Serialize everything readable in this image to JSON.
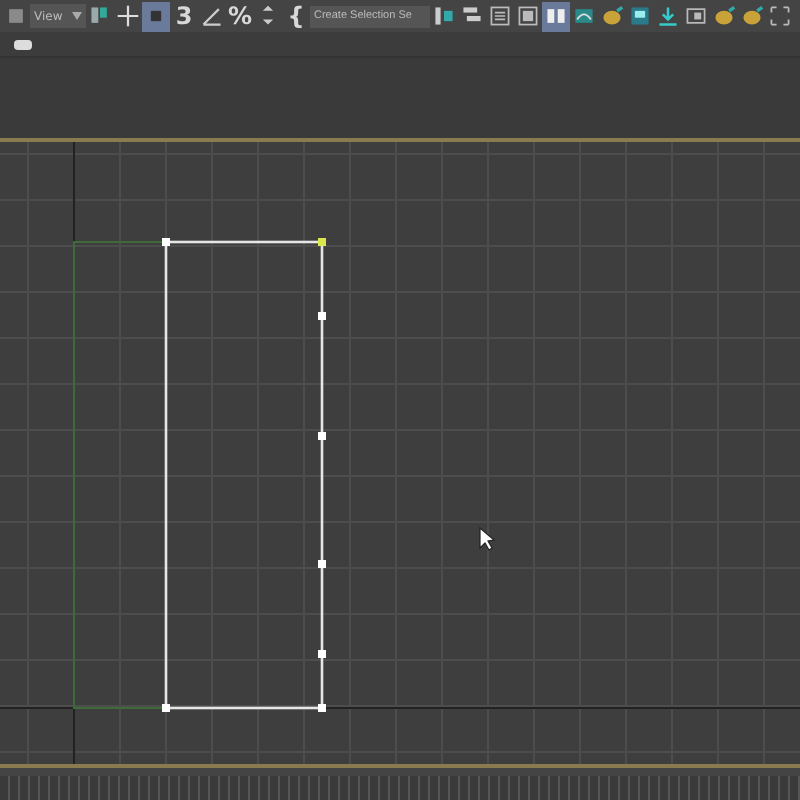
{
  "toolbar": {
    "items": [
      {
        "kind": "icon",
        "selected": false
      },
      {
        "kind": "dropdown",
        "value": "View"
      },
      {
        "kind": "icon",
        "selected": false
      },
      {
        "kind": "icon",
        "selected": false
      },
      {
        "kind": "icon",
        "selected": true
      },
      {
        "kind": "glyph",
        "label": "3",
        "selected": false
      },
      {
        "kind": "icon",
        "selected": false
      },
      {
        "kind": "glyph",
        "label": "%",
        "selected": false
      },
      {
        "kind": "icon",
        "selected": false
      },
      {
        "kind": "glyph",
        "label": "{",
        "selected": false
      },
      {
        "kind": "field",
        "placeholder": "Create Selection Se"
      },
      {
        "kind": "icon",
        "selected": false
      },
      {
        "kind": "icon",
        "selected": false
      },
      {
        "kind": "icon",
        "selected": false
      },
      {
        "kind": "icon",
        "selected": false
      },
      {
        "kind": "icon",
        "selected": true
      },
      {
        "kind": "icon",
        "selected": false
      },
      {
        "kind": "icon",
        "selected": false
      },
      {
        "kind": "icon",
        "selected": false
      },
      {
        "kind": "icon",
        "selected": false
      },
      {
        "kind": "icon",
        "selected": false
      },
      {
        "kind": "icon",
        "selected": false
      },
      {
        "kind": "icon",
        "selected": false
      },
      {
        "kind": "icon",
        "selected": false
      }
    ]
  },
  "subbar": {
    "kind": "toggle"
  }
}
